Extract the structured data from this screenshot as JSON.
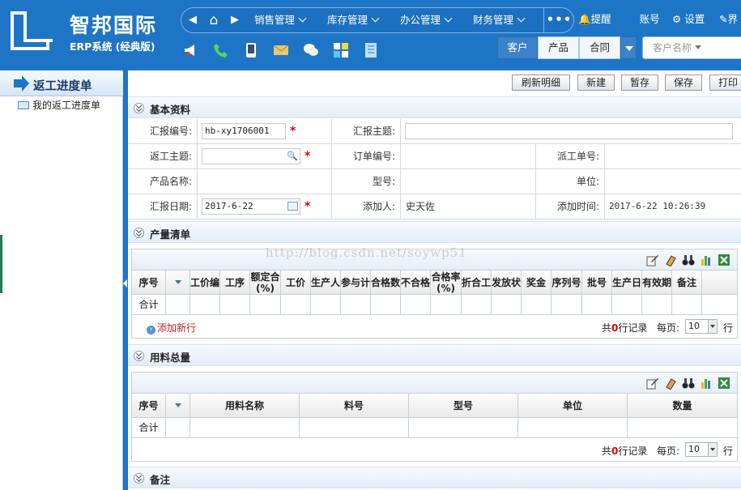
{
  "brand": {
    "title": "智邦国际",
    "subtitle": "ERP系统 (经典版)"
  },
  "topnav": {
    "prev": "◀",
    "home": "⌂",
    "next": "▶",
    "menus": [
      "销售管理",
      "库存管理",
      "办公管理",
      "财务管理"
    ],
    "more": "•••"
  },
  "toplinks": {
    "remind": "提醒",
    "account": "账号",
    "settings": "设置",
    "exit": "界"
  },
  "segments": [
    "客户",
    "产品",
    "合同"
  ],
  "search": {
    "placeholder": "客户名称"
  },
  "sidebar": {
    "title": "返工进度单",
    "item": "我的返工进度单"
  },
  "actions": [
    "刷新明细",
    "新建",
    "暂存",
    "保存",
    "打印"
  ],
  "sections": {
    "basic": "基本资料",
    "output": "产量清单",
    "material": "用料总量",
    "remark": "备注"
  },
  "form": {
    "report_no_label": "汇报编号:",
    "report_no_value": "hb-xy1706001",
    "report_subject_label": "汇报主题:",
    "rework_subject_label": "返工主题:",
    "order_no_label": "订单编号:",
    "dispatch_no_label": "派工单号:",
    "product_name_label": "产品名称:",
    "model_label": "型号:",
    "unit_label": "单位:",
    "report_date_label": "汇报日期:",
    "report_date_value": "2017-6-22",
    "adder_label": "添加人:",
    "adder_value": "史天佐",
    "add_time_label": "添加时间:",
    "add_time_value": "2017-6-22 10:26:39"
  },
  "output_grid": {
    "headers": [
      "序号",
      "",
      "工价编",
      "工序",
      "额定合(%)",
      "工价",
      "生产人",
      "参与计",
      "合格数",
      "不合格",
      "合格率(%)",
      "折合工",
      "发放状",
      "奖金",
      "序列号",
      "批号",
      "生产日",
      "有效期",
      "备注"
    ],
    "total_label": "合计"
  },
  "material_grid": {
    "headers": [
      "序号",
      "",
      "用料名称",
      "料号",
      "型号",
      "单位",
      "数量"
    ],
    "total_label": "合计"
  },
  "footer": {
    "add_row": "添加新行",
    "total_prefix": "共",
    "total_count": "0",
    "total_suffix": "行记录",
    "per_page_label": "每页:",
    "per_page_value": "10",
    "unit": "行"
  },
  "watermark": "http://blog.csdn.net/soywp51",
  "colors": {
    "header_blue": "#1e75c6",
    "required_red": "#dd0000"
  }
}
